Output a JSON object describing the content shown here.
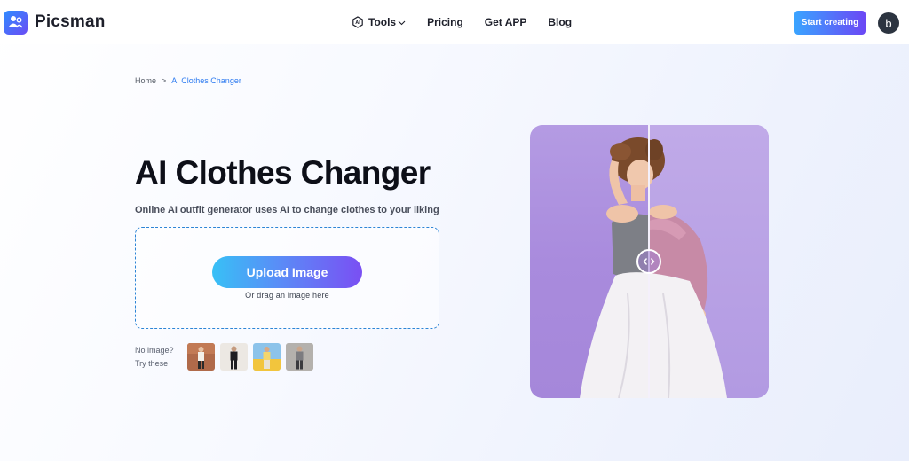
{
  "header": {
    "brand": "Picsman",
    "nav": [
      {
        "label": "Tools",
        "has_dropdown": true,
        "icon": "ai-hexagon-icon"
      },
      {
        "label": "Pricing"
      },
      {
        "label": "Get APP"
      },
      {
        "label": "Blog"
      }
    ],
    "cta_label": "Start creating",
    "avatar_initial": "b"
  },
  "breadcrumb": {
    "home": "Home",
    "separator": ">",
    "current": "AI Clothes Changer"
  },
  "hero": {
    "title": "AI Clothes Changer",
    "subtitle": "Online AI outfit generator uses AI to change clothes to your liking",
    "upload_label": "Upload Image",
    "drag_hint": "Or drag an image here",
    "no_image_line1": "No image?",
    "no_image_line2": "Try these",
    "samples": [
      "sample-brown-outfit",
      "sample-black-outfit",
      "sample-yellow-outfit",
      "sample-grey-outfit"
    ]
  },
  "colors": {
    "accent_blue": "#2d7bf0",
    "gradient_start": "#38c0f6",
    "gradient_end": "#7a4ff3",
    "photo_bg": "#b49be3"
  }
}
